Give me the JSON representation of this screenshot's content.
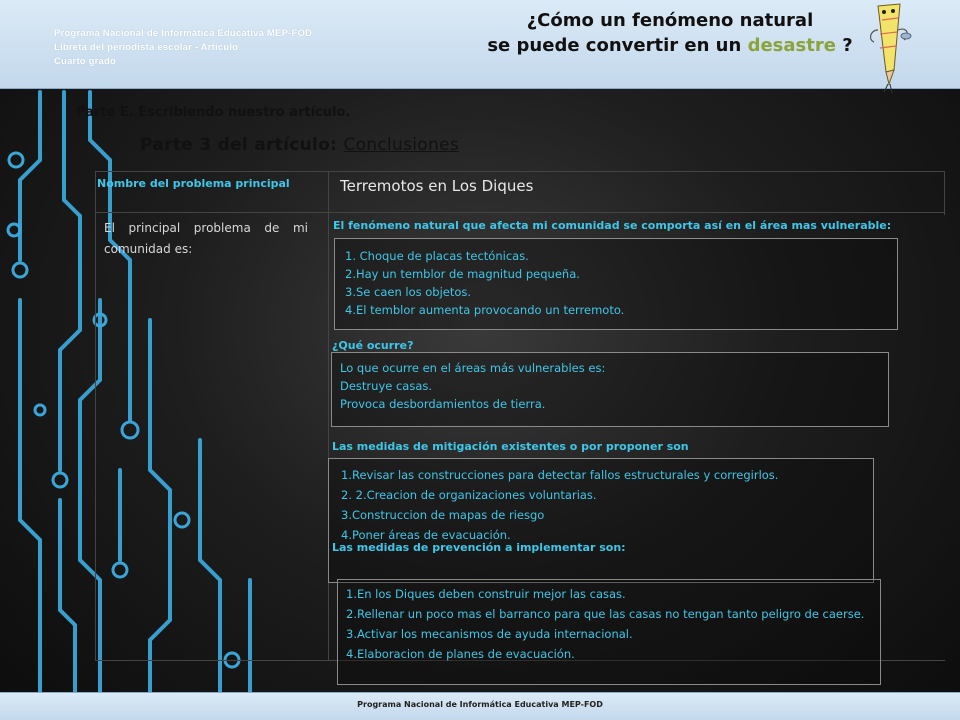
{
  "header": {
    "program_lines": [
      "Programa Nacional de Informática Educativa MEP-FOD",
      "Libreta del periodista escolar - Artículo",
      "Cuarto grado"
    ],
    "title_line1": "¿Cómo un fenómeno natural",
    "title_line2_pre": "se puede convertir en un ",
    "title_line2_accent": "desastre",
    "title_line2_post": " ?",
    "accent_color": "#8aa33a"
  },
  "section": {
    "parte": "Parte E. Escribiendo nuestro artículo.",
    "parte3_prefix": "Parte 3 del artículo: ",
    "parte3_link": "Conclusiones"
  },
  "table": {
    "nombre_label": "Nombre del problema principal",
    "nombre_value": "Terremotos en Los Diques",
    "principal_label": "El principal problema de mi comunidad es:"
  },
  "fenomeno": {
    "label": "El fenómeno natural que afecta mi comunidad se comporta así en el área mas vulnerable:",
    "items": [
      "1. Choque de placas tectónicas.",
      "2.Hay un temblor de magnitud pequeña.",
      "3.Se caen los objetos.",
      "4.El temblor aumenta provocando un terremoto."
    ]
  },
  "ocurre": {
    "label": "¿Qué ocurre?",
    "items": [
      "Lo que ocurre en el áreas más vulnerables es:",
      "Destruye casas.",
      "Provoca desbordamientos de tierra."
    ]
  },
  "mitigacion": {
    "label": "Las medidas de mitigación existentes o por proponer son",
    "items": [
      "1.Revisar las construcciones para detectar fallos estructurales y corregirlos.",
      "2. 2.Creacion de organizaciones voluntarias.",
      "3.Construccion de mapas de riesgo",
      "4.Poner áreas de evacuación."
    ]
  },
  "prevencion": {
    "label": "Las medidas de prevención a implementar son:",
    "items": [
      "1.En los Diques deben construir mejor las casas.",
      "2.Rellenar un poco mas el barranco para que las casas no tengan tanto peligro de caerse.",
      "3.Activar los mecanismos de ayuda internacional.",
      "4.Elaboracion de planes de evacuación."
    ]
  },
  "footer": {
    "text": "Programa Nacional de Informática Educativa MEP-FOD"
  },
  "colors": {
    "cyan_text": "#3fc7e8",
    "circuit": "#2f9fd0"
  }
}
